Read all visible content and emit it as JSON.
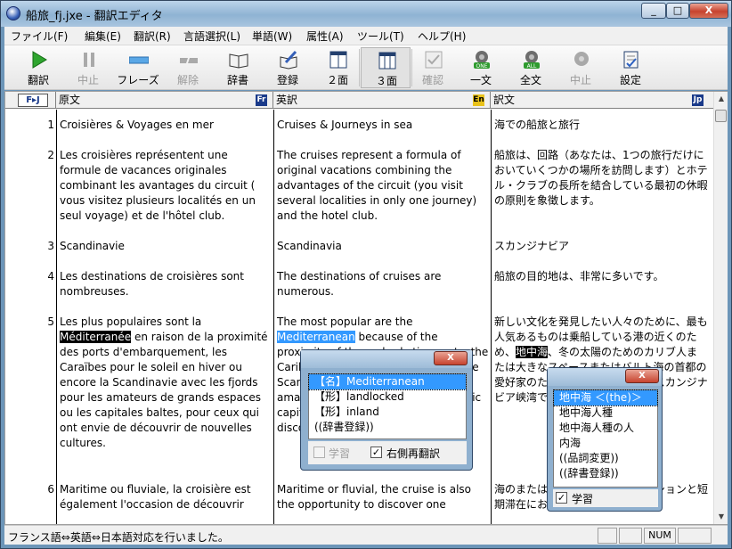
{
  "window": {
    "title": "船旅_fj.jxe - 翻訳エディタ",
    "min": "_",
    "max": "□",
    "close": "X"
  },
  "menu": [
    "ファイル(F)",
    "編集(E)",
    "翻訳(R)",
    "言語選択(L)",
    "単語(W)",
    "属性(A)",
    "ツール(T)",
    "ヘルプ(H)"
  ],
  "toolbar": [
    {
      "label": "翻訳",
      "icon": "play-icon",
      "disabled": false
    },
    {
      "label": "中止",
      "icon": "pause-icon",
      "disabled": true
    },
    {
      "label": "フレーズ",
      "icon": "phrase-icon",
      "disabled": false
    },
    {
      "label": "解除",
      "icon": "unphrase-icon",
      "disabled": true
    },
    {
      "label": "辞書",
      "icon": "book-icon",
      "disabled": false
    },
    {
      "label": "登録",
      "icon": "register-icon",
      "disabled": false
    },
    {
      "label": "２面",
      "icon": "two-pane-icon",
      "disabled": false
    },
    {
      "label": "３面",
      "icon": "three-pane-icon",
      "disabled": false
    },
    {
      "label": "確認",
      "icon": "check-icon",
      "disabled": true
    },
    {
      "label": "一文",
      "icon": "one-sentence-icon",
      "disabled": false
    },
    {
      "label": "全文",
      "icon": "all-text-icon",
      "disabled": false
    },
    {
      "label": "中止",
      "icon": "stop-speech-icon",
      "disabled": true
    },
    {
      "label": "設定",
      "icon": "settings-icon",
      "disabled": false
    }
  ],
  "columns": {
    "lang_pair": "F▸J",
    "c1": "原文",
    "c1_flag": "Fr",
    "c2": "英訳",
    "c2_flag": "En",
    "c3": "訳文",
    "c3_flag": "Jp"
  },
  "rows": [
    {
      "num": "1",
      "fr": "Croisières & Voyages en mer",
      "en": "Cruises & Journeys in sea",
      "ja": "海での船旅と旅行"
    },
    {
      "num": "2",
      "fr": "Les croisières représentent une formule de vacances originales combinant les avantages du circuit ( vous visitez plusieurs localités en un seul voyage) et de l'hôtel club.",
      "en": "The cruises represent a formula of original vacations combining the advantages of the circuit (you visit several localities in only one journey)  and the hotel club.",
      "ja": "船旅は、回路（あなたは、1つの旅行だけにおいていくつかの場所を訪問します）とホテル・クラブの長所を結合している最初の休暇の原則を象徴します。"
    },
    {
      "num": "3",
      "fr": "Scandinavie",
      "en": "Scandinavia",
      "ja": "スカンジナビア"
    },
    {
      "num": "4",
      "fr": "Les destinations de croisières sont nombreuses.",
      "en": "The destinations of cruises are numerous.",
      "ja": "船旅の目的地は、非常に多いです。"
    },
    {
      "num": "5",
      "fr_before": "Les plus populaires sont la ",
      "fr_hl": "Méditerranée",
      "fr_after": " en raison de la proximité des ports d'embarquement, les Caraïbes pour le soleil en hiver ou encore la Scandinavie avec les fjords pour les amateurs de grands espaces ou les capitales baltes, pour ceux qui ont envie de découvrir de nouvelles cultures.",
      "en_before": "The most popular are the ",
      "en_hl": "Mediterranean",
      "en_after": " because of the proximity of the embarkation ports, the Caribbean for the sun in winter or the Scandinavia with the fjords for the amateurs of large spaces or the Baltic capitals, for those which wish to discover new cultures.",
      "ja_before": "新しい文化を発見したい人々のために、最も人気あるものは乗船している港の近くのため、",
      "ja_hl": "地中海",
      "ja_after": "、冬の太陽のためのカリブ人または大きなスペースまたはバルト海の首都の愛好家のためのフィヨルドを持つスカンジナビア峡湾です。"
    },
    {
      "num": "6",
      "fr": "Maritime ou fluviale, la croisière est également l'occasion de découvrir",
      "en": "Maritime or fluvial, the cruise is also the opportunity to discover one",
      "ja": "海のまたは河川の、船旅は、ミッションと短期滞在においてライフ"
    }
  ],
  "popup_en": {
    "close": "X",
    "items": [
      "【名】Mediterranean",
      "【形】landlocked",
      "【形】inland",
      "((辞書登録))"
    ],
    "learn_label": "学習",
    "retranslate_label": "右側再翻訳",
    "retranslate_checked": true,
    "learn_checked": false
  },
  "popup_ja": {
    "close": "X",
    "items": [
      "地中海 ＜(the)＞",
      "地中海人種",
      "地中海人種の人",
      "内海",
      "((品詞変更))",
      "((辞書登録))"
    ],
    "learn_label": "学習",
    "learn_checked": true
  },
  "status": {
    "text": "フランス語⇔英語⇔日本語対応を行いました。",
    "num": "NUM"
  }
}
